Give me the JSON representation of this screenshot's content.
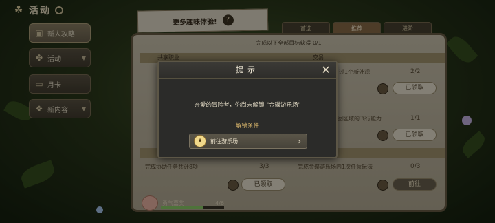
{
  "sidebar": {
    "header_title": "活动",
    "items": [
      {
        "label": "新人攻略",
        "active": true,
        "has_chevron": false
      },
      {
        "label": "活动",
        "active": false,
        "has_chevron": true
      },
      {
        "label": "月卡",
        "active": false,
        "has_chevron": false
      },
      {
        "label": "新内容",
        "active": false,
        "has_chevron": true
      }
    ]
  },
  "note": {
    "text": "更多趣味体验!",
    "help_icon": "question-icon"
  },
  "tabs": [
    {
      "label": "首选",
      "selected": false
    },
    {
      "label": "推荐",
      "selected": true
    },
    {
      "label": "进阶",
      "selected": false
    }
  ],
  "book": {
    "progress_text": "完成以下全部目标获得 0/1",
    "left_section": "共享职业",
    "right_section": "交易",
    "rows": [
      {
        "right_text": "过1个新外观",
        "right_count": "2/2",
        "right_button": "已领取"
      },
      {
        "right_text": "地图区域的飞行能力",
        "right_count": "1/1",
        "right_button": "已领取"
      },
      {
        "left_text": "完成协助任务共计8项",
        "left_count": "3/3",
        "left_button": "已领取",
        "right_text": "完成金碟游乐场内1次任意玩法",
        "right_count": "0/3",
        "right_button": "前往"
      }
    ]
  },
  "dialog": {
    "title": "提示",
    "message": "亲爱的冒险者，你尚未解锁 \"金碟游乐场\"",
    "condition_label": "解锁条件",
    "goto_label": "前往游乐场",
    "close_icon": "close-icon"
  },
  "reward": {
    "label": "勇气嘉奖",
    "count": "4/6",
    "progress": 0.6667
  }
}
